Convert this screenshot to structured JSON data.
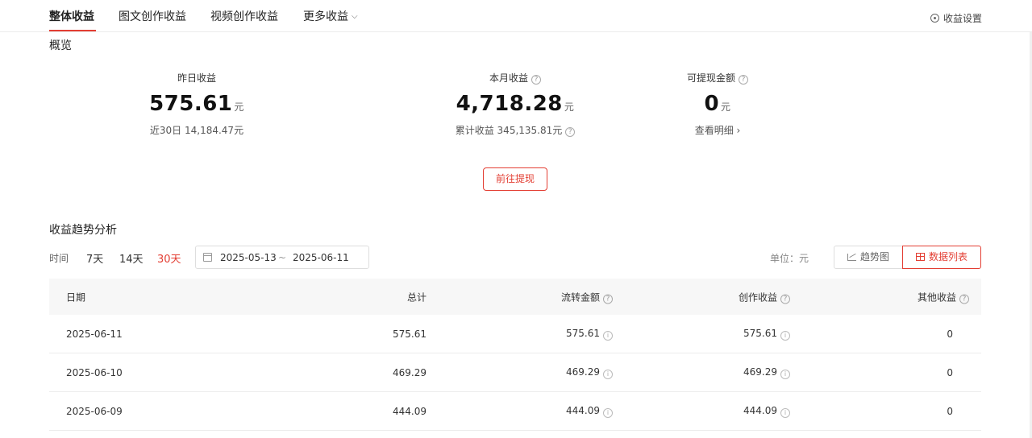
{
  "nav": {
    "tabs": [
      {
        "label": "整体收益"
      },
      {
        "label": "图文创作收益"
      },
      {
        "label": "视频创作收益"
      },
      {
        "label": "更多收益"
      }
    ],
    "settings_label": "收益设置"
  },
  "overview": {
    "title": "概览",
    "yesterday": {
      "label": "昨日收益",
      "value": "575.61",
      "unit": "元",
      "sub": "近30日 14,184.47元"
    },
    "month": {
      "label": "本月收益",
      "value": "4,718.28",
      "unit": "元",
      "sub": "累计收益 345,135.81元"
    },
    "withdrawable": {
      "label": "可提现金额",
      "value": "0",
      "unit": "元",
      "sub": "查看明细 ›"
    },
    "withdraw_button": "前往提现",
    "help_glyph": "?"
  },
  "trend": {
    "title": "收益趋势分析",
    "time_label": "时间",
    "ranges": [
      {
        "label": "7天",
        "active": false
      },
      {
        "label": "14天",
        "active": false
      },
      {
        "label": "30天",
        "active": true
      }
    ],
    "date_start": "2025-05-13",
    "date_sep": "~",
    "date_end": "2025-06-11",
    "unit_label": "单位：元",
    "view_trend": "趋势图",
    "view_list": "数据列表",
    "accent_color": "#e33e33"
  },
  "table": {
    "headers": {
      "date": "日期",
      "total": "总计",
      "flow": "流转金额",
      "create": "创作收益",
      "other": "其他收益"
    },
    "rows": [
      {
        "date": "2025-06-11",
        "total": "575.61",
        "flow": "575.61",
        "create": "575.61",
        "other": "0"
      },
      {
        "date": "2025-06-10",
        "total": "469.29",
        "flow": "469.29",
        "create": "469.29",
        "other": "0"
      },
      {
        "date": "2025-06-09",
        "total": "444.09",
        "flow": "444.09",
        "create": "444.09",
        "other": "0"
      }
    ],
    "info_glyph": "i"
  }
}
